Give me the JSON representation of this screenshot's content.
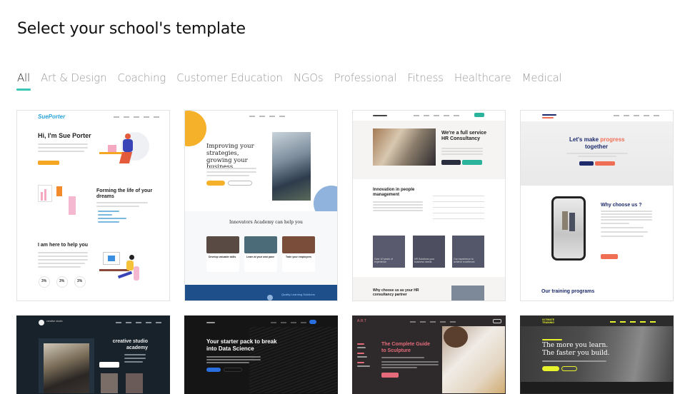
{
  "page": {
    "title": "Select your school's template"
  },
  "tabs": [
    {
      "label": "All",
      "active": true
    },
    {
      "label": "Art & Design",
      "active": false
    },
    {
      "label": "Coaching",
      "active": false
    },
    {
      "label": "Customer Education",
      "active": false
    },
    {
      "label": "NGOs",
      "active": false
    },
    {
      "label": "Professional",
      "active": false
    },
    {
      "label": "Fitness",
      "active": false
    },
    {
      "label": "Healthcare",
      "active": false
    },
    {
      "label": "Medical",
      "active": false
    }
  ],
  "colors": {
    "accent": "#3cc6b6"
  },
  "templates": [
    {
      "logo": "SuePorter",
      "hero": "Hi, I'm Sue Porter",
      "section2": "Forming the life of your dreams",
      "section3": "I am here to help you",
      "stats": [
        "3%",
        "3%",
        "3%"
      ],
      "colors": {
        "button": "#f5a623",
        "logo": "#2aa4d9"
      }
    },
    {
      "hero": "Improving your strategies, growing your business",
      "section": "Innovators Academy can help you",
      "cards": [
        "Develop valuable skills",
        "Learn at your own pace",
        "Train your employees"
      ],
      "footer": "Quality Learning Solutions",
      "colors": {
        "accent": "#f6b12b",
        "footer": "#1f4f8a",
        "circle": "#8fb3dc"
      }
    },
    {
      "hero": "We're a full service HR Consultancy",
      "section": "Innovation in people management",
      "tiles": [
        "Over 10 years of experience",
        "HR Solutions your business needs",
        "Our experience to achieve excellence"
      ],
      "footer": "Why choose us as your HR consultancy partner",
      "colors": {
        "button_dark": "#2a2d3e",
        "button_accent": "#2bb39b"
      }
    },
    {
      "hero_part1": "Let's make ",
      "hero_highlight": "progress",
      "hero_part2": "together",
      "section": "Why choose us ?",
      "footer": "Our training programs",
      "colors": {
        "navy": "#1d2a6b",
        "coral": "#f06e54"
      }
    },
    {
      "logo": "creative studio",
      "hero": "creative studio academy",
      "colors": {
        "bg": "#18222b"
      }
    },
    {
      "hero": "Your starter pack to break into Data Science",
      "colors": {
        "bg": "#151516",
        "button": "#2a6fe0"
      }
    },
    {
      "logo": "A.R.T",
      "hero": "The Complete Guide to Sculpture",
      "colors": {
        "bg": "#2e2a2b",
        "accent": "#e56b7a"
      }
    },
    {
      "logo": "ULTIMATE TRAINING",
      "hero_line1": "The more you learn.",
      "hero_line2": "The faster you build.",
      "colors": {
        "bg": "#2c2c2c",
        "accent": "#e6f32c"
      }
    }
  ]
}
